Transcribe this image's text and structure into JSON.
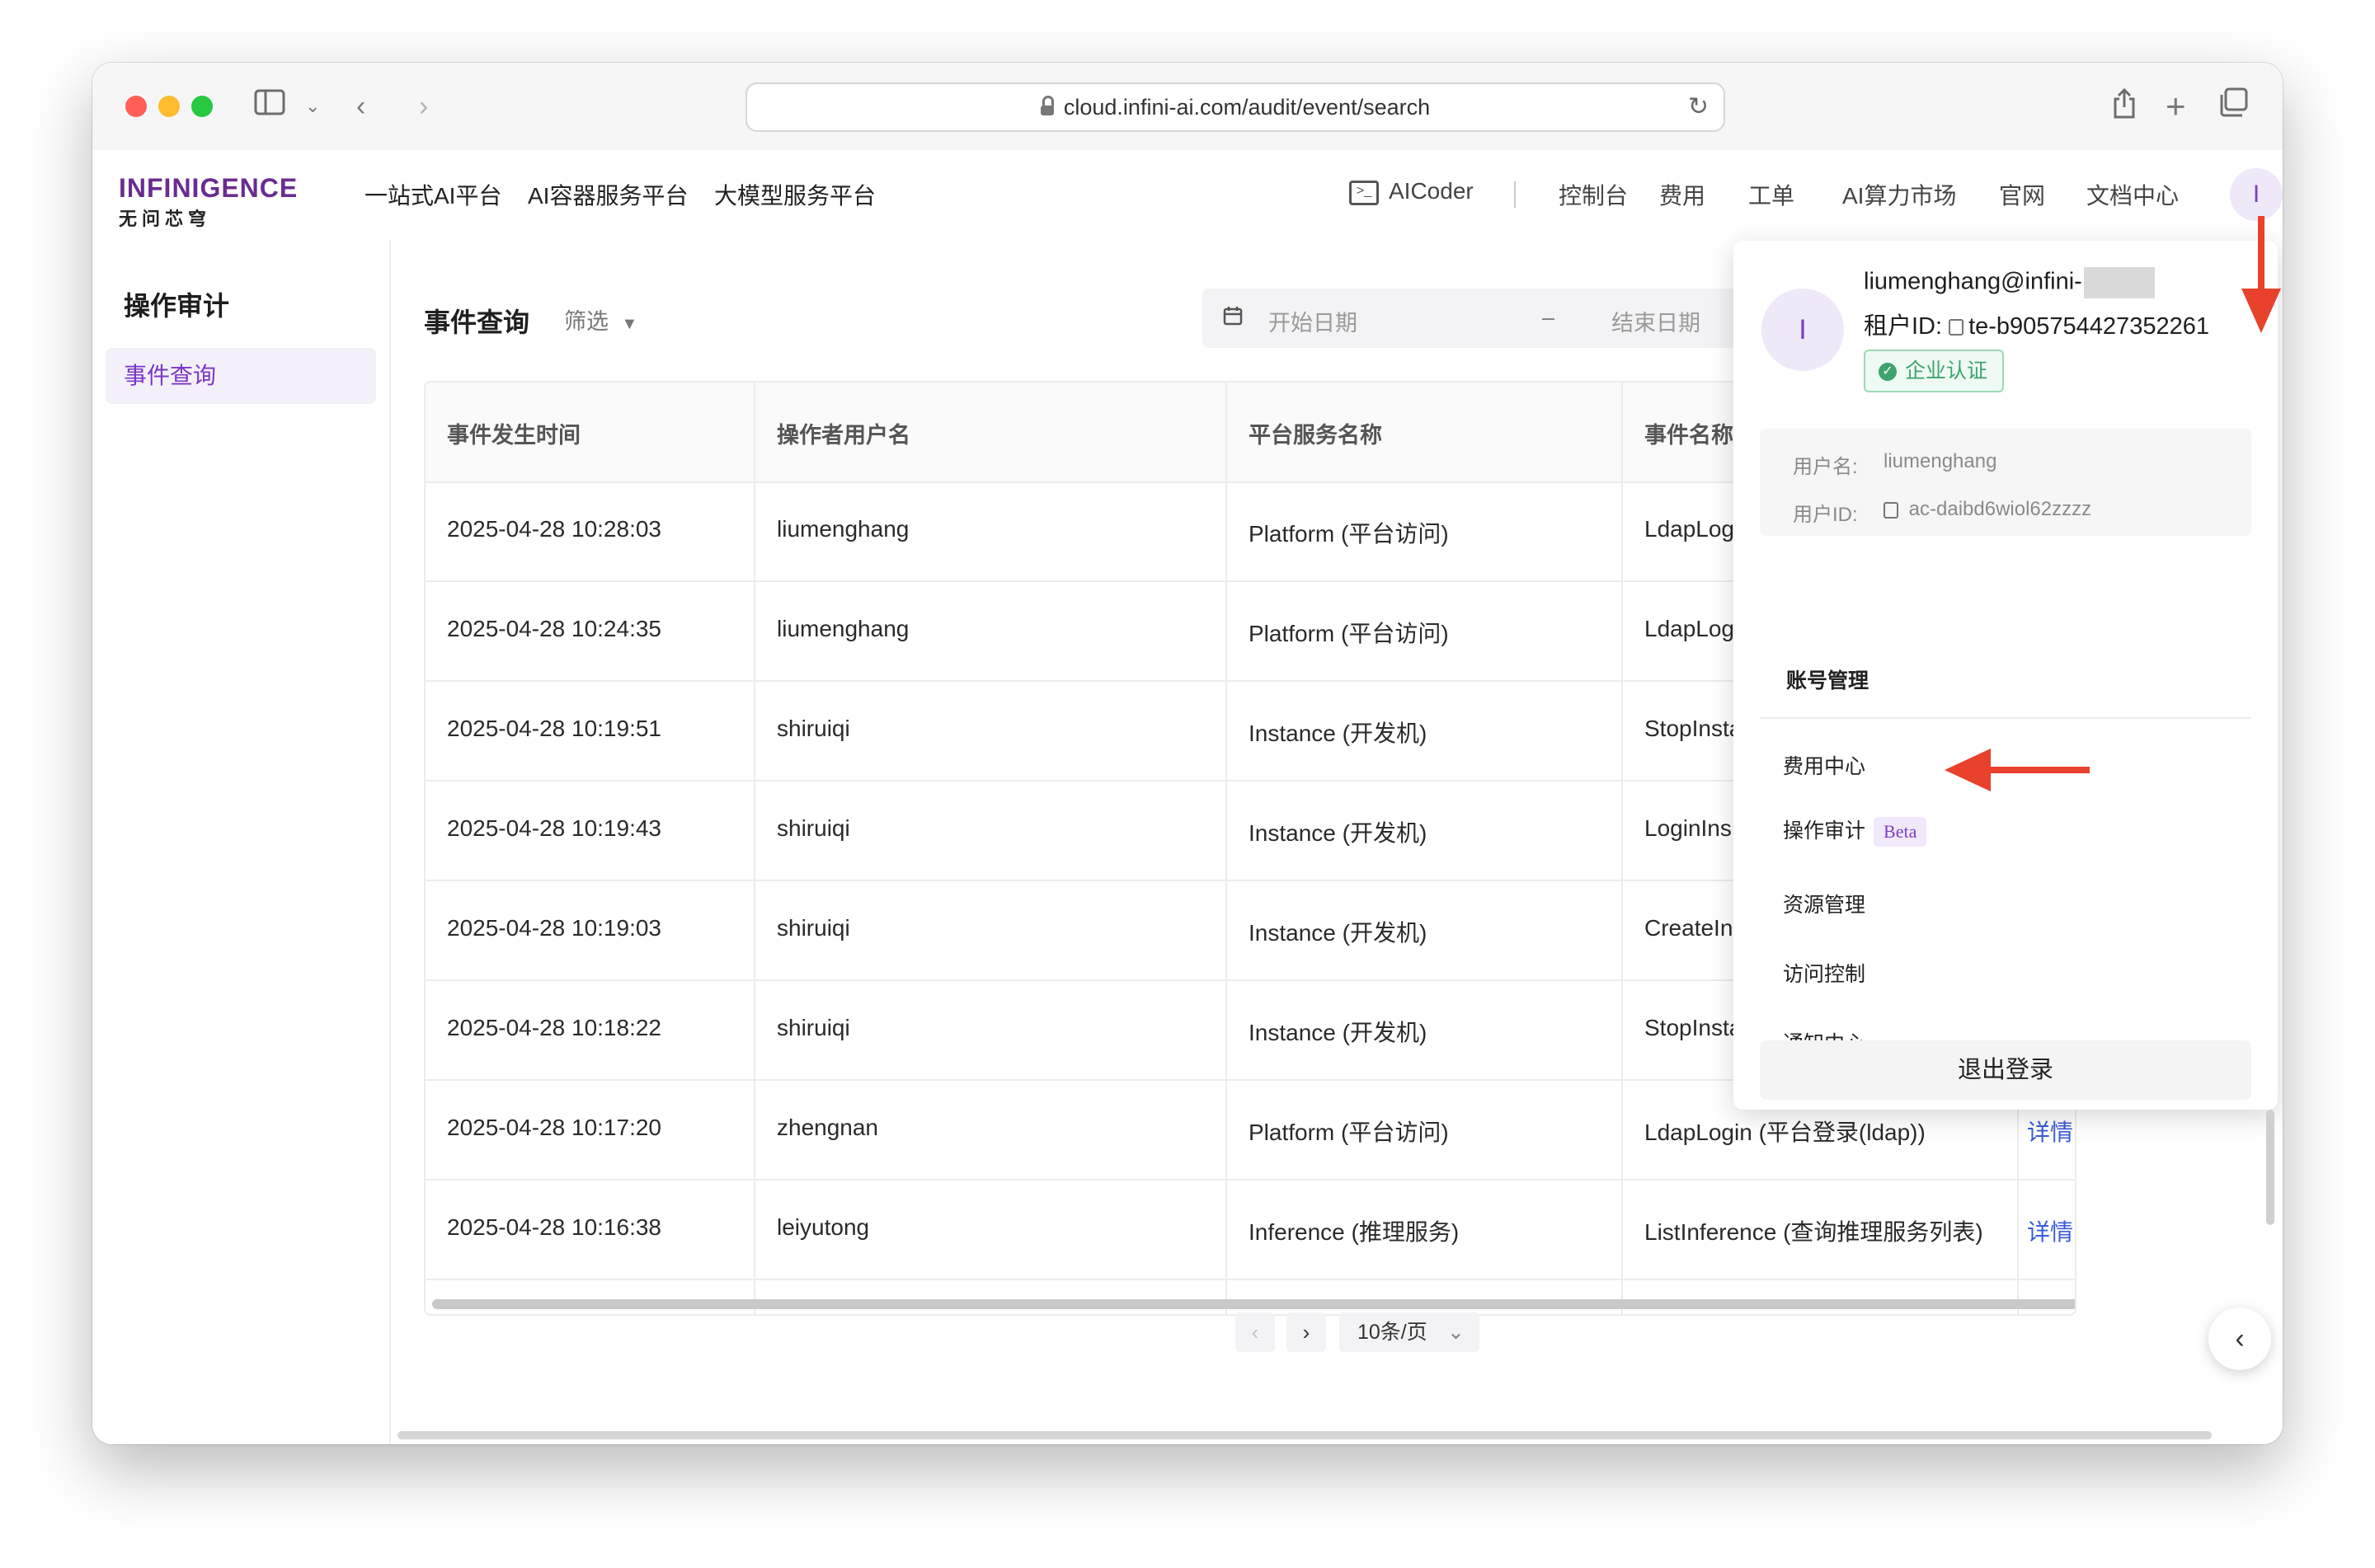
{
  "browser": {
    "url": "cloud.infini-ai.com/audit/event/search"
  },
  "brand": {
    "logo_text": "INFINIGENCE",
    "logo_sub": "无问芯穹"
  },
  "topnav": {
    "left_items": [
      "一站式AI平台",
      "AI容器服务平台",
      "大模型服务平台"
    ],
    "aicoder": "AICoder",
    "right_items": [
      "控制台",
      "费用",
      "工单",
      "AI算力市场",
      "官网",
      "文档中心"
    ],
    "avatar_initial": "I"
  },
  "sidebar": {
    "title": "操作审计",
    "items": [
      {
        "label": "事件查询",
        "active": true
      }
    ]
  },
  "main": {
    "title": "事件查询",
    "filter_label": "筛选",
    "start_date_placeholder": "开始日期",
    "date_separator": "–",
    "end_date_placeholder": "结束日期",
    "table": {
      "columns": [
        "事件发生时间",
        "操作者用户名",
        "平台服务名称",
        "事件名称"
      ],
      "rows": [
        {
          "time": "2025-04-28 10:28:03",
          "user": "liumenghang",
          "service": "Platform (平台访问)",
          "event": "LdapLog",
          "action": ""
        },
        {
          "time": "2025-04-28 10:24:35",
          "user": "liumenghang",
          "service": "Platform (平台访问)",
          "event": "LdapLog",
          "action": ""
        },
        {
          "time": "2025-04-28 10:19:51",
          "user": "shiruiqi",
          "service": "Instance (开发机)",
          "event": "StopInsta",
          "action": ""
        },
        {
          "time": "2025-04-28 10:19:43",
          "user": "shiruiqi",
          "service": "Instance (开发机)",
          "event": "LoginIns",
          "action": ""
        },
        {
          "time": "2025-04-28 10:19:03",
          "user": "shiruiqi",
          "service": "Instance (开发机)",
          "event": "CreateIn",
          "action": ""
        },
        {
          "time": "2025-04-28 10:18:22",
          "user": "shiruiqi",
          "service": "Instance (开发机)",
          "event": "StopInsta",
          "action": ""
        },
        {
          "time": "2025-04-28 10:17:20",
          "user": "zhengnan",
          "service": "Platform (平台访问)",
          "event": "LdapLogin (平台登录(ldap))",
          "action": "详情"
        },
        {
          "time": "2025-04-28 10:16:38",
          "user": "leiyutong",
          "service": "Inference (推理服务)",
          "event": "ListInference (查询推理服务列表)",
          "action": "详情"
        }
      ]
    },
    "pagination": {
      "prev_icon": "‹",
      "next_icon": "›",
      "page_size": "10条/页"
    }
  },
  "account_dropdown": {
    "email": "liumenghang@infini-",
    "tenant_label": "租户ID:",
    "tenant_id": "te-b905754427352261",
    "verified_badge": "企业认证",
    "username_label": "用户名:",
    "username": "liumenghang",
    "userid_label": "用户ID:",
    "userid": "ac-daibd6wiol62zzzz",
    "menu": [
      "账号管理",
      "费用中心",
      "操作审计",
      "资源管理",
      "访问控制",
      "通知中心"
    ],
    "beta_label": "Beta",
    "logout": "退出登录"
  },
  "colors": {
    "brand_purple": "#7a36c4",
    "link_blue": "#3b5bdb",
    "annotation_red": "#e8412c",
    "verified_green": "#3ea36d"
  }
}
